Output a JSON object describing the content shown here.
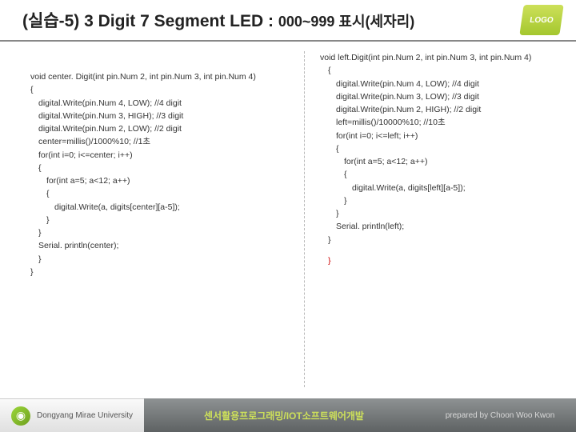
{
  "header": {
    "title_prefix": "(실습-5) 3 Digit 7 Segment LED : ",
    "title_suffix": "000~999 표시(세자리)",
    "badge": "LOGO"
  },
  "left": {
    "l0": "void center. Digit(int pin.Num 2, int pin.Num 3, int pin.Num 4)",
    "l1": "{",
    "l2": "digital.Write(pin.Num 4, LOW); //4 digit",
    "l3": "digital.Write(pin.Num 3, HIGH); //3 digit",
    "l4": "digital.Write(pin.Num 2, LOW); //2 digit",
    "l5": "center=millis()/1000%10; //1초",
    "l6": "for(int i=0; i<=center; i++)",
    "l7": "{",
    "l8": "for(int a=5; a<12; a++)",
    "l9": "{",
    "l10": "digital.Write(a, digits[center][a-5]);",
    "l11": "}",
    "l12": "}",
    "l13": "Serial. println(center);",
    "l14": "}",
    "l15": "}"
  },
  "right": {
    "r0": "void left.Digit(int pin.Num 2, int pin.Num 3, int pin.Num 4)",
    "r1": "{",
    "r2": "digital.Write(pin.Num 4, LOW); //4 digit",
    "r3": "digital.Write(pin.Num 3, LOW); //3 digit",
    "r4": "digital.Write(pin.Num 2, HIGH); //2 digit",
    "r5": "left=millis()/10000%10; //10초",
    "r6": "for(int i=0; i<=left; i++)",
    "r7": "{",
    "r8": "for(int a=5; a<12; a++)",
    "r9": "{",
    "r10": "digital.Write(a, digits[left][a-5]);",
    "r11": "}",
    "r12": "}",
    "r13": "Serial. println(left);",
    "r14": "}",
    "r15": "}"
  },
  "footer": {
    "university": "Dongyang Mirae University",
    "course": "센서활용프로그래밍/IOT소프트웨어개발",
    "prepared": "prepared by Choon Woo Kwon"
  }
}
